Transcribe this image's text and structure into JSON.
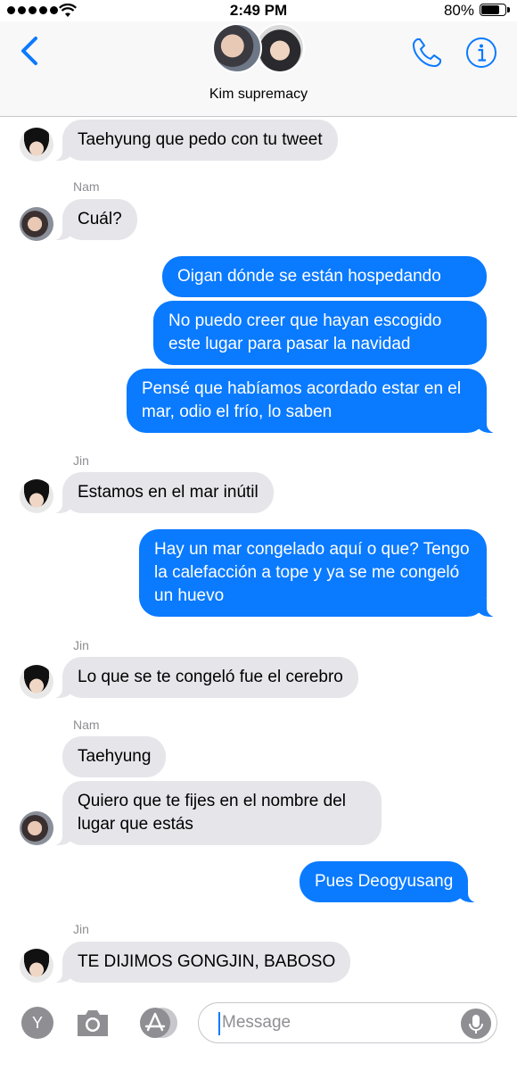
{
  "status_bar": {
    "time": "2:49 PM",
    "battery": "80%"
  },
  "header": {
    "title": "Kim supremacy"
  },
  "messages": [
    {
      "text": "Taehyung que pedo con tu tweet"
    },
    {
      "sender": "Nam",
      "text": "Cuál?"
    },
    {
      "text": "Oigan dónde se están hospedando"
    },
    {
      "text": "No puedo creer que hayan escogido este lugar para pasar la navidad"
    },
    {
      "text": "Pensé que habíamos acordado estar en el mar, odio el frío, lo saben"
    },
    {
      "sender": "Jin",
      "text": "Estamos en el mar inútil"
    },
    {
      "text": "Hay un mar congelado aquí o que? Tengo la calefacción a tope y ya se me congeló un huevo"
    },
    {
      "sender": "Jin",
      "text": "Lo que se te congeló fue el cerebro"
    },
    {
      "sender": "Nam",
      "text": "Taehyung"
    },
    {
      "text": "Quiero que te fijes en el nombre del lugar que estás"
    },
    {
      "text": "Pues Deogyusang"
    },
    {
      "sender": "Jin",
      "text": "TE DIJIMOS GONGJIN, BABOSO"
    }
  ],
  "input_bar": {
    "placeholder": "Message",
    "app_drawer_label": "Y"
  },
  "colors": {
    "accent": "#0a7aff",
    "incoming_bubble": "#e5e5ea"
  }
}
